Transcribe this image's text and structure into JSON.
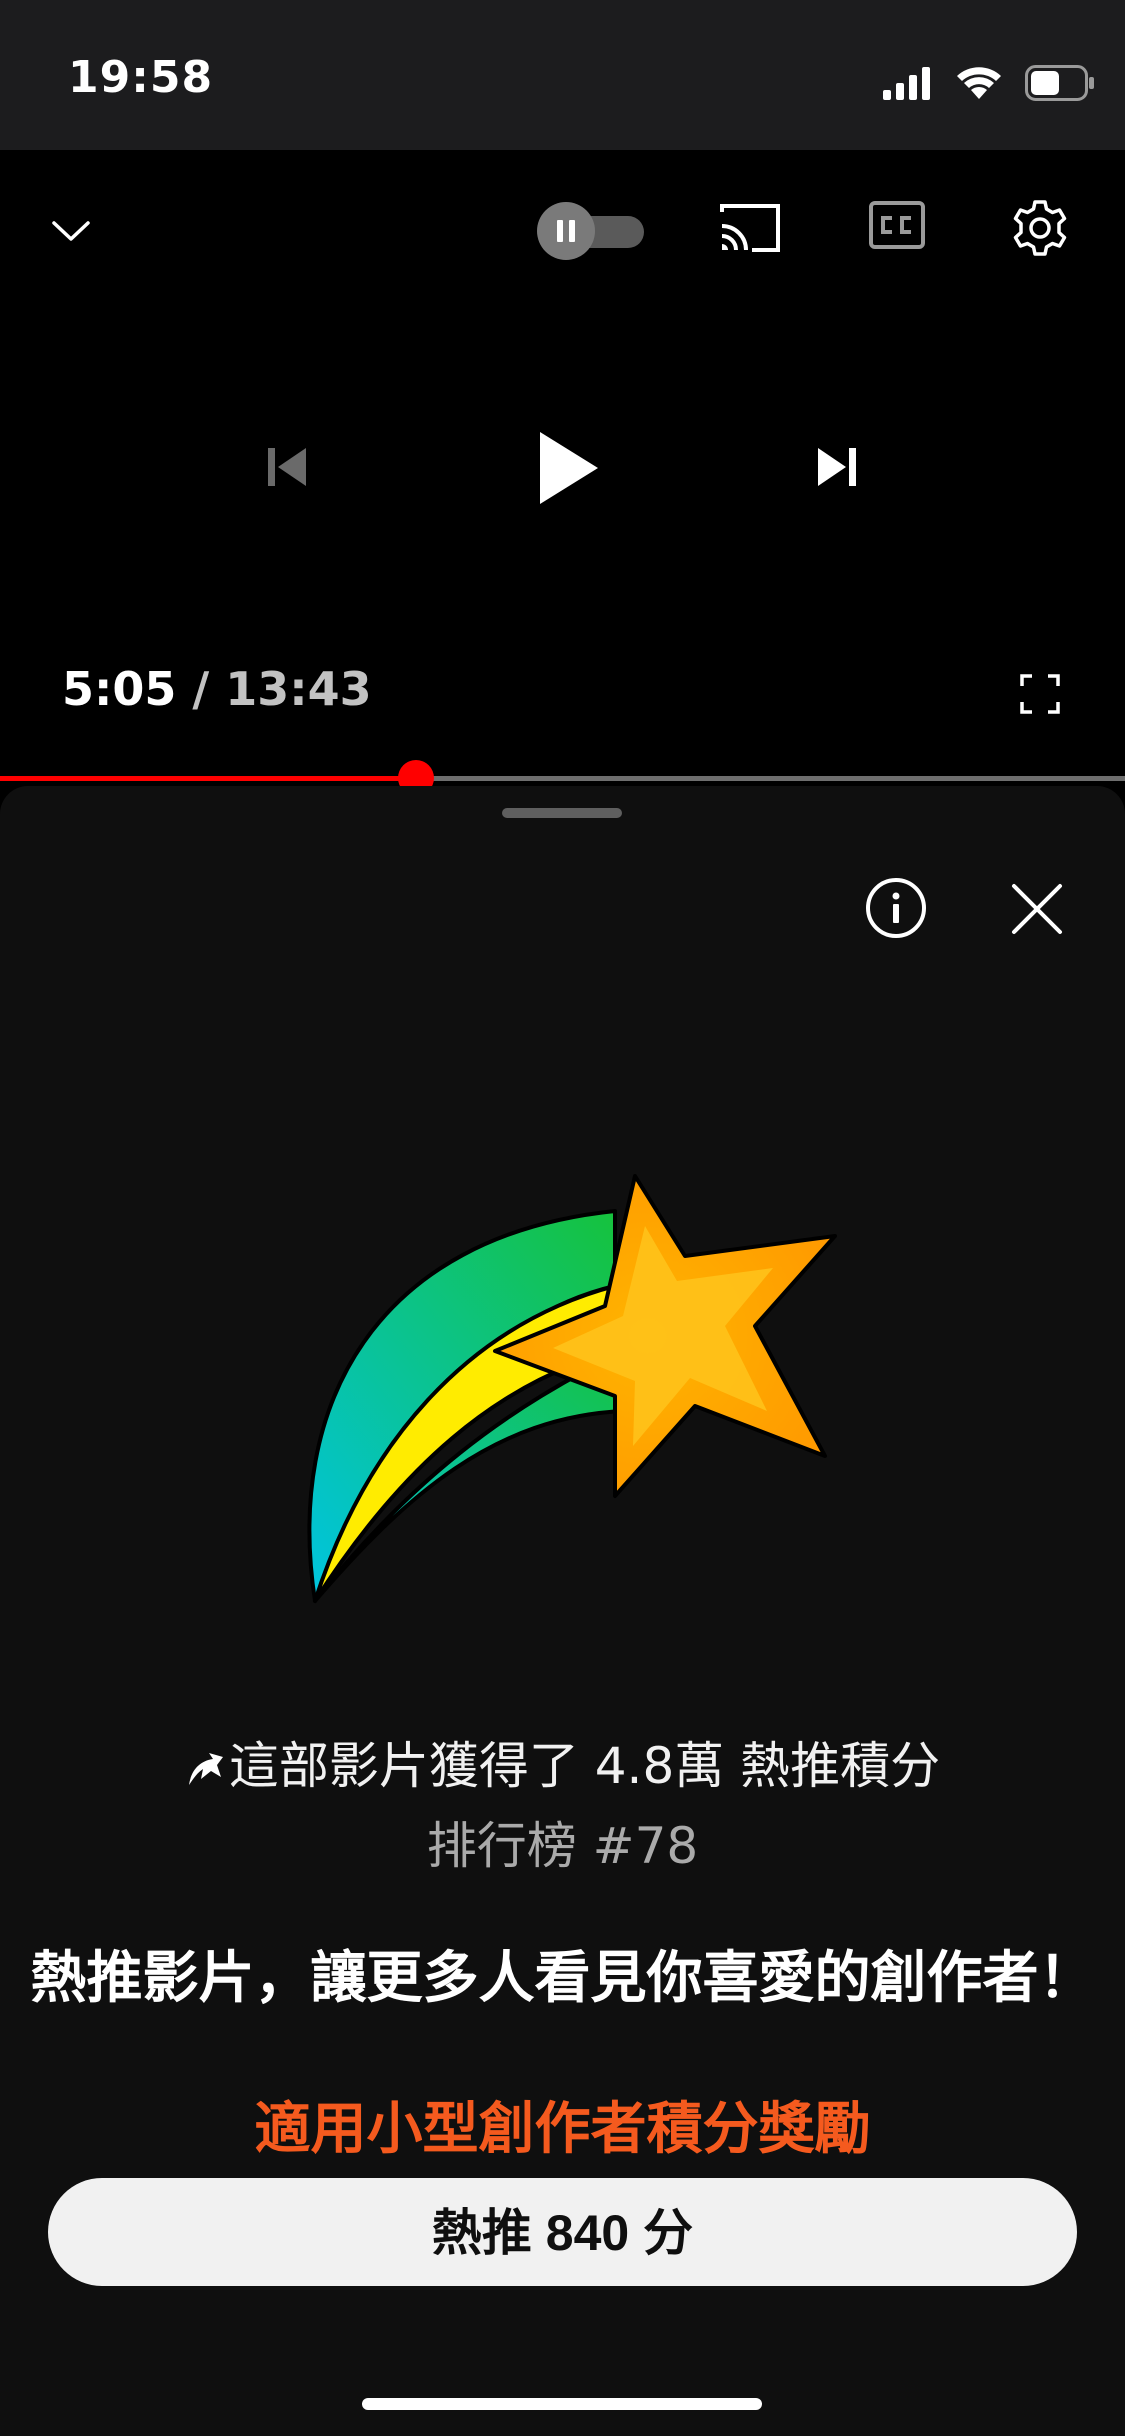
{
  "status_bar": {
    "time": "19:58",
    "battery_level": 0.55
  },
  "player": {
    "current_time": "5:05",
    "separator": " / ",
    "total_time": "13:43",
    "progress": 0.37
  },
  "sheet": {
    "points_text": "這部影片獲得了 4.8萬 熱推積分",
    "rank_text": "排行榜 #78",
    "headline": "熱推影片，讓更多人看見你喜愛的創作者！",
    "bonus_text": "適用小型創作者積分獎勵",
    "cta_label": "熱推 840 分"
  },
  "colors": {
    "accent_red": "#ff0000",
    "bonus_orange": "#f55a1e",
    "sheet_bg": "#0f0f0f"
  }
}
